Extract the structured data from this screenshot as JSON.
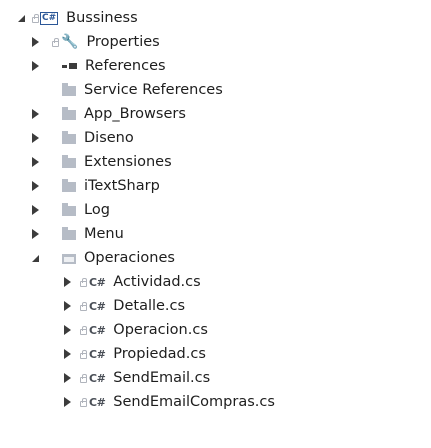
{
  "tree": {
    "project": {
      "label": "Bussiness",
      "icon": "csharp-project-icon",
      "badge": "C#"
    },
    "properties": {
      "label": "Properties",
      "icon": "wrench-icon"
    },
    "references": {
      "label": "References",
      "icon": "references-icon"
    },
    "folders": [
      {
        "label": "Service References",
        "icon": "folder-icon"
      },
      {
        "label": "App_Browsers",
        "icon": "folder-icon"
      },
      {
        "label": "Diseno",
        "icon": "folder-icon"
      },
      {
        "label": "Extensiones",
        "icon": "folder-icon"
      },
      {
        "label": "iTextSharp",
        "icon": "folder-icon"
      },
      {
        "label": "Log",
        "icon": "folder-icon"
      },
      {
        "label": "Menu",
        "icon": "folder-icon"
      },
      {
        "label": "Operaciones",
        "icon": "folder-open-icon"
      }
    ],
    "files": [
      {
        "label": "Actividad.cs",
        "icon": "csharp-file-icon",
        "badge": "C#"
      },
      {
        "label": "Detalle.cs",
        "icon": "csharp-file-icon",
        "badge": "C#"
      },
      {
        "label": "Operacion.cs",
        "icon": "csharp-file-icon",
        "badge": "C#"
      },
      {
        "label": "Propiedad.cs",
        "icon": "csharp-file-icon",
        "badge": "C#"
      },
      {
        "label": "SendEmail.cs",
        "icon": "csharp-file-icon",
        "badge": "C#"
      },
      {
        "label": "SendEmailCompras.cs",
        "icon": "csharp-file-icon",
        "badge": "C#"
      }
    ]
  },
  "colors": {
    "text": "#1e1e1e",
    "folder": "#b6bcc6",
    "project": "#2b5797",
    "expander": "#3c3c3c"
  }
}
